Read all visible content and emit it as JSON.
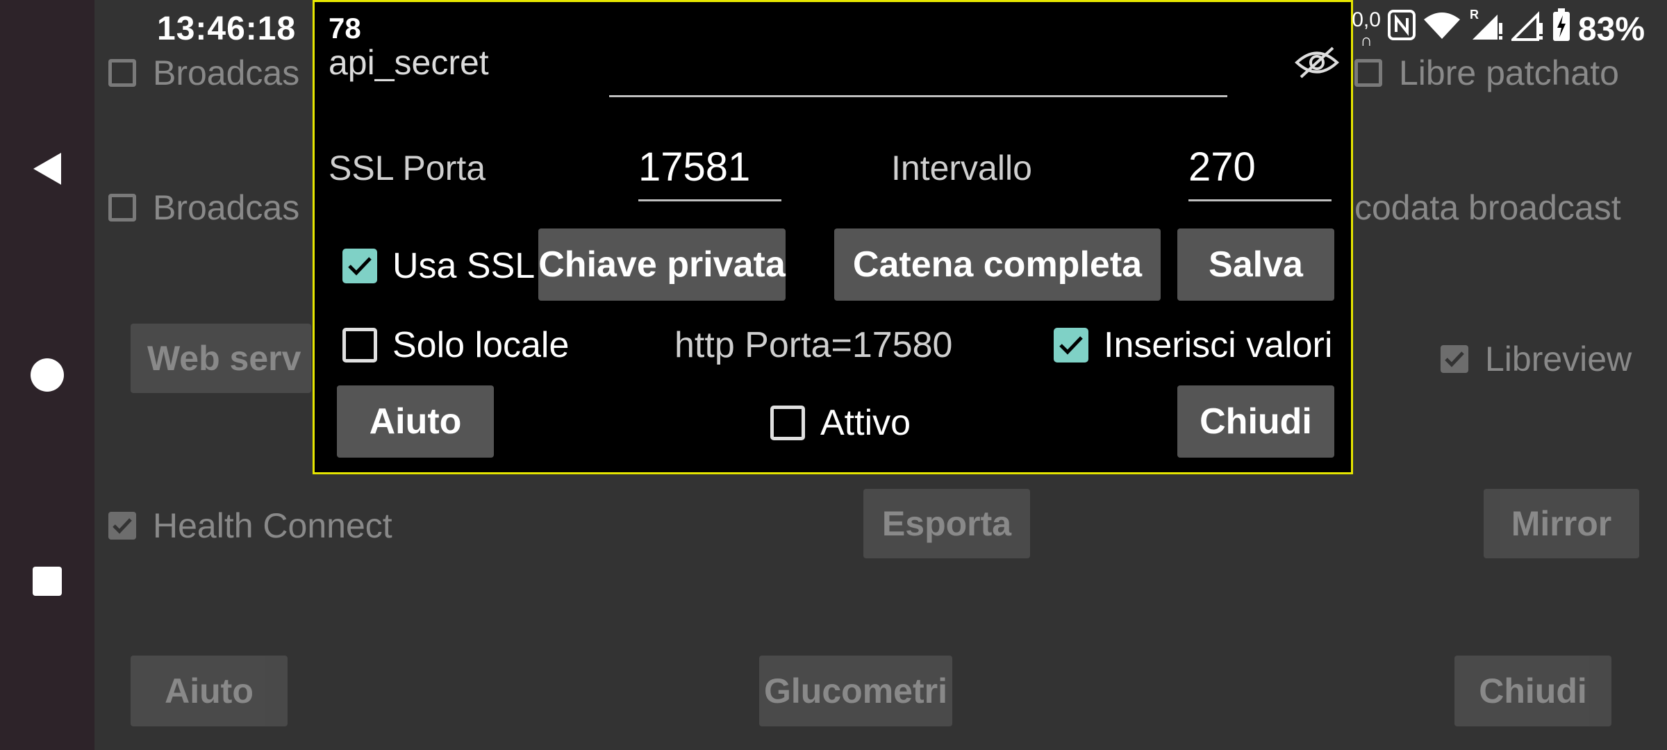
{
  "status_bar": {
    "time": "13:46:18",
    "battery": "83%",
    "data_rate": "0,0"
  },
  "background": {
    "check_broadcast_1": "Broadcas",
    "check_broadcast_2": "Broadcas",
    "check_libre_patched": "Libre patchato",
    "check_nocodata": "codata broadcast",
    "btn_web_server": "Web serv",
    "check_libreview": "Libreview",
    "check_health_connect": "Health Connect",
    "btn_export": "Esporta",
    "btn_mirror": "Mirror",
    "btn_help": "Aiuto",
    "btn_glucometers": "Glucometri",
    "btn_close": "Chiudi"
  },
  "dialog": {
    "badge": "78",
    "api_secret_label": "api_secret",
    "ssl_port_label": "SSL Porta",
    "ssl_port_value": "17581",
    "interval_label": "Intervallo",
    "interval_value": "270",
    "use_ssl_label": "Usa SSL",
    "use_ssl_checked": true,
    "private_key_button": "Chiave privata",
    "full_chain_button": "Catena completa",
    "save_button": "Salva",
    "local_only_label": "Solo locale",
    "local_only_checked": false,
    "http_port_text": "http Porta=17580",
    "insert_values_label": "Inserisci valori",
    "insert_values_checked": true,
    "help_button": "Aiuto",
    "active_label": "Attivo",
    "active_checked": false,
    "close_button": "Chiudi"
  },
  "colors": {
    "accent_check": "#7fd1c6",
    "dialog_border": "#e6e600",
    "button_bg": "#555555"
  }
}
